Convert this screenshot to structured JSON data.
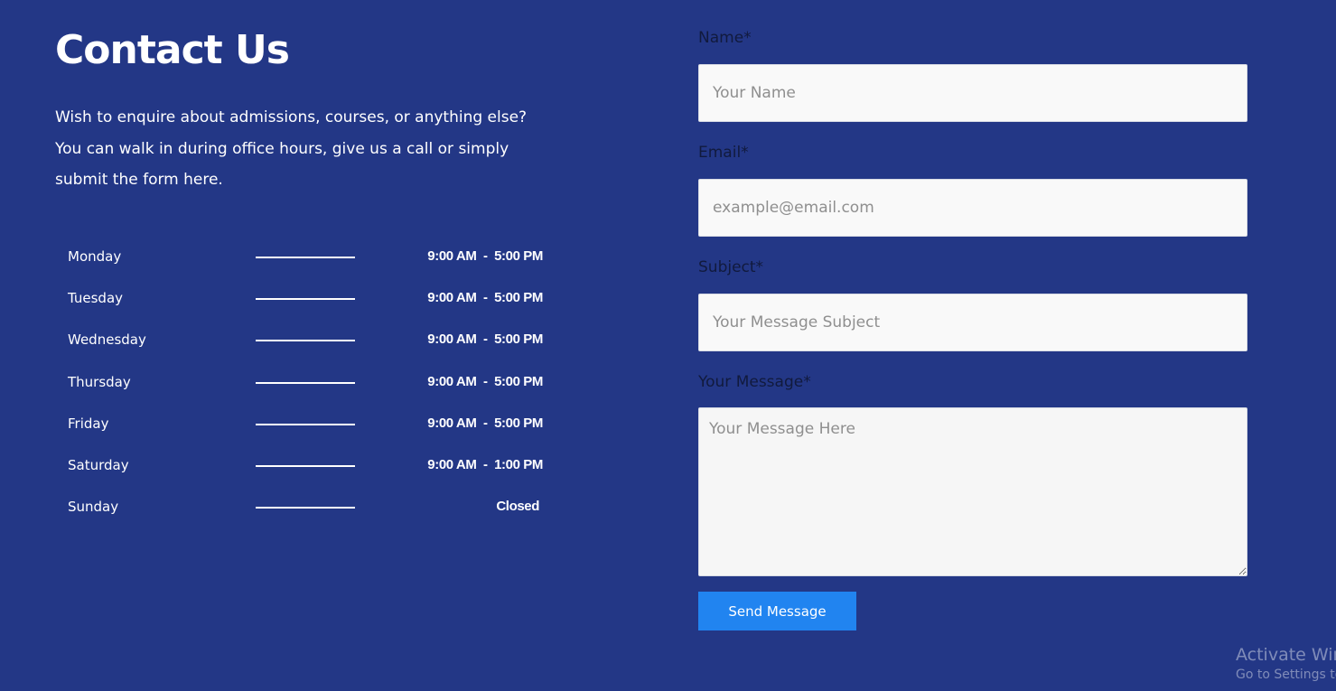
{
  "contact": {
    "title": "Contact Us",
    "intro_line_1": "Wish to enquire about admissions, courses, or anything else?",
    "intro_line_2": "You can walk in during office hours, give us a call or simply",
    "intro_line_3": "submit the form here."
  },
  "office_hours": [
    {
      "day": "Monday",
      "hours": "9:00 AM  -  5:00 PM"
    },
    {
      "day": "Tuesday",
      "hours": "9:00 AM  -  5:00 PM"
    },
    {
      "day": "Wednesday",
      "hours": "9:00 AM  -  5:00 PM"
    },
    {
      "day": "Thursday",
      "hours": "9:00 AM  -  5:00 PM"
    },
    {
      "day": "Friday",
      "hours": "9:00 AM  -  5:00 PM"
    },
    {
      "day": "Saturday",
      "hours": "9:00 AM  -  1:00 PM"
    },
    {
      "day": "Sunday",
      "hours": "Closed"
    }
  ],
  "form": {
    "name": {
      "label": "Name*",
      "placeholder": "Your Name",
      "value": ""
    },
    "email": {
      "label": "Email*",
      "placeholder": "example@email.com",
      "value": ""
    },
    "subject": {
      "label": "Subject*",
      "placeholder": "Your Message Subject",
      "value": ""
    },
    "message": {
      "label": "Your Message*",
      "placeholder": "Your Message Here",
      "value": ""
    },
    "submit_label": "Send Message"
  },
  "watermark": {
    "title": "Activate Windows",
    "subtitle": "Go to Settings to activate Windows."
  },
  "colors": {
    "background": "#233786",
    "field_background": "#f9f9f9",
    "button": "#2184f0",
    "label_text": "#111a3d",
    "placeholder_text": "#8f8f8f"
  }
}
